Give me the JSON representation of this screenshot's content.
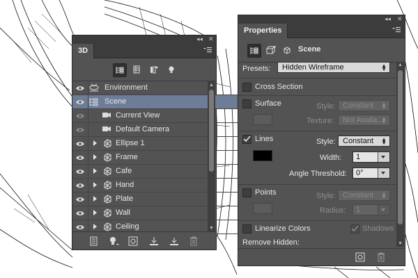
{
  "layers_panel": {
    "tab_label": "3D",
    "window_controls": {
      "collapse": "◂◂",
      "close": "✕"
    },
    "toolbar_icons": [
      "whole-scene-filter-icon",
      "meshes-filter-icon",
      "materials-filter-icon",
      "lights-filter-icon"
    ],
    "items": [
      {
        "label": "Environment",
        "icon": "environment-icon",
        "expandable": false,
        "selected": false,
        "eye_dim": false
      },
      {
        "label": "Scene",
        "icon": "scene-icon",
        "expandable": false,
        "selected": true,
        "eye_dim": false
      },
      {
        "label": "Current View",
        "icon": "camera-icon",
        "expandable": false,
        "selected": false,
        "eye_dim": true
      },
      {
        "label": "Default Camera",
        "icon": "camera-icon",
        "expandable": false,
        "selected": false,
        "eye_dim": true
      },
      {
        "label": "Ellipse 1",
        "icon": "mesh-icon",
        "expandable": true,
        "selected": false,
        "eye_dim": false
      },
      {
        "label": "Frame",
        "icon": "mesh-icon",
        "expandable": true,
        "selected": false,
        "eye_dim": false
      },
      {
        "label": "Cafe",
        "icon": "mesh-icon",
        "expandable": true,
        "selected": false,
        "eye_dim": false
      },
      {
        "label": "Hand",
        "icon": "mesh-icon",
        "expandable": true,
        "selected": false,
        "eye_dim": false
      },
      {
        "label": "Plate",
        "icon": "mesh-icon",
        "expandable": true,
        "selected": false,
        "eye_dim": false
      },
      {
        "label": "Wall",
        "icon": "mesh-icon",
        "expandable": true,
        "selected": false,
        "eye_dim": false
      },
      {
        "label": "Ceiling",
        "icon": "mesh-icon",
        "expandable": true,
        "selected": false,
        "eye_dim": false
      }
    ],
    "bottom_icons": [
      "render-settings-icon",
      "add-light-icon",
      "new-object-icon",
      "move-to-ground-icon",
      "render-icon",
      "delete-icon"
    ]
  },
  "properties_panel": {
    "tab_label": "Properties",
    "window_controls": {
      "collapse": "◂◂",
      "close": "✕"
    },
    "header_label": "Scene",
    "presets": {
      "label": "Presets:",
      "value": "Hidden Wireframe"
    },
    "cross_section": {
      "label": "Cross Section",
      "checked": false
    },
    "surface": {
      "label": "Surface",
      "checked": false,
      "style_label": "Style:",
      "style_value": "Constant",
      "texture_label": "Texture:",
      "texture_value": "Not Availa..."
    },
    "lines": {
      "label": "Lines",
      "checked": true,
      "style_label": "Style:",
      "style_value": "Constant",
      "color": "#000000",
      "width_label": "Width:",
      "width_value": "1",
      "angle_label": "Angle Threshold:",
      "angle_value": "0°"
    },
    "points": {
      "label": "Points",
      "checked": false,
      "style_label": "Style:",
      "style_value": "Constant",
      "radius_label": "Radius:",
      "radius_value": "1"
    },
    "linearize": {
      "label": "Linearize Colors",
      "checked": false
    },
    "shadows": {
      "label": "Shadows",
      "checked": true
    },
    "remove_hidden": {
      "label": "Remove Hidden:"
    }
  }
}
